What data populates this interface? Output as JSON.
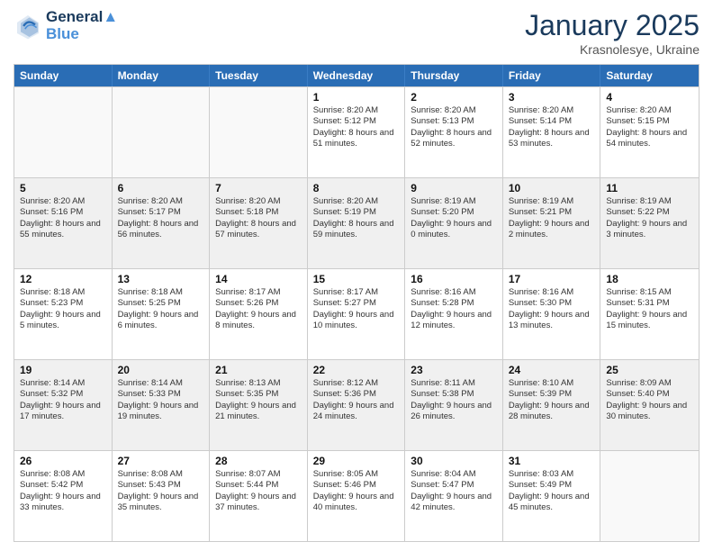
{
  "header": {
    "logo_line1": "General",
    "logo_line2": "Blue",
    "month_title": "January 2025",
    "location": "Krasnolesye, Ukraine"
  },
  "weekdays": [
    "Sunday",
    "Monday",
    "Tuesday",
    "Wednesday",
    "Thursday",
    "Friday",
    "Saturday"
  ],
  "rows": [
    [
      {
        "day": "",
        "text": ""
      },
      {
        "day": "",
        "text": ""
      },
      {
        "day": "",
        "text": ""
      },
      {
        "day": "1",
        "text": "Sunrise: 8:20 AM\nSunset: 5:12 PM\nDaylight: 8 hours and 51 minutes."
      },
      {
        "day": "2",
        "text": "Sunrise: 8:20 AM\nSunset: 5:13 PM\nDaylight: 8 hours and 52 minutes."
      },
      {
        "day": "3",
        "text": "Sunrise: 8:20 AM\nSunset: 5:14 PM\nDaylight: 8 hours and 53 minutes."
      },
      {
        "day": "4",
        "text": "Sunrise: 8:20 AM\nSunset: 5:15 PM\nDaylight: 8 hours and 54 minutes."
      }
    ],
    [
      {
        "day": "5",
        "text": "Sunrise: 8:20 AM\nSunset: 5:16 PM\nDaylight: 8 hours and 55 minutes."
      },
      {
        "day": "6",
        "text": "Sunrise: 8:20 AM\nSunset: 5:17 PM\nDaylight: 8 hours and 56 minutes."
      },
      {
        "day": "7",
        "text": "Sunrise: 8:20 AM\nSunset: 5:18 PM\nDaylight: 8 hours and 57 minutes."
      },
      {
        "day": "8",
        "text": "Sunrise: 8:20 AM\nSunset: 5:19 PM\nDaylight: 8 hours and 59 minutes."
      },
      {
        "day": "9",
        "text": "Sunrise: 8:19 AM\nSunset: 5:20 PM\nDaylight: 9 hours and 0 minutes."
      },
      {
        "day": "10",
        "text": "Sunrise: 8:19 AM\nSunset: 5:21 PM\nDaylight: 9 hours and 2 minutes."
      },
      {
        "day": "11",
        "text": "Sunrise: 8:19 AM\nSunset: 5:22 PM\nDaylight: 9 hours and 3 minutes."
      }
    ],
    [
      {
        "day": "12",
        "text": "Sunrise: 8:18 AM\nSunset: 5:23 PM\nDaylight: 9 hours and 5 minutes."
      },
      {
        "day": "13",
        "text": "Sunrise: 8:18 AM\nSunset: 5:25 PM\nDaylight: 9 hours and 6 minutes."
      },
      {
        "day": "14",
        "text": "Sunrise: 8:17 AM\nSunset: 5:26 PM\nDaylight: 9 hours and 8 minutes."
      },
      {
        "day": "15",
        "text": "Sunrise: 8:17 AM\nSunset: 5:27 PM\nDaylight: 9 hours and 10 minutes."
      },
      {
        "day": "16",
        "text": "Sunrise: 8:16 AM\nSunset: 5:28 PM\nDaylight: 9 hours and 12 minutes."
      },
      {
        "day": "17",
        "text": "Sunrise: 8:16 AM\nSunset: 5:30 PM\nDaylight: 9 hours and 13 minutes."
      },
      {
        "day": "18",
        "text": "Sunrise: 8:15 AM\nSunset: 5:31 PM\nDaylight: 9 hours and 15 minutes."
      }
    ],
    [
      {
        "day": "19",
        "text": "Sunrise: 8:14 AM\nSunset: 5:32 PM\nDaylight: 9 hours and 17 minutes."
      },
      {
        "day": "20",
        "text": "Sunrise: 8:14 AM\nSunset: 5:33 PM\nDaylight: 9 hours and 19 minutes."
      },
      {
        "day": "21",
        "text": "Sunrise: 8:13 AM\nSunset: 5:35 PM\nDaylight: 9 hours and 21 minutes."
      },
      {
        "day": "22",
        "text": "Sunrise: 8:12 AM\nSunset: 5:36 PM\nDaylight: 9 hours and 24 minutes."
      },
      {
        "day": "23",
        "text": "Sunrise: 8:11 AM\nSunset: 5:38 PM\nDaylight: 9 hours and 26 minutes."
      },
      {
        "day": "24",
        "text": "Sunrise: 8:10 AM\nSunset: 5:39 PM\nDaylight: 9 hours and 28 minutes."
      },
      {
        "day": "25",
        "text": "Sunrise: 8:09 AM\nSunset: 5:40 PM\nDaylight: 9 hours and 30 minutes."
      }
    ],
    [
      {
        "day": "26",
        "text": "Sunrise: 8:08 AM\nSunset: 5:42 PM\nDaylight: 9 hours and 33 minutes."
      },
      {
        "day": "27",
        "text": "Sunrise: 8:08 AM\nSunset: 5:43 PM\nDaylight: 9 hours and 35 minutes."
      },
      {
        "day": "28",
        "text": "Sunrise: 8:07 AM\nSunset: 5:44 PM\nDaylight: 9 hours and 37 minutes."
      },
      {
        "day": "29",
        "text": "Sunrise: 8:05 AM\nSunset: 5:46 PM\nDaylight: 9 hours and 40 minutes."
      },
      {
        "day": "30",
        "text": "Sunrise: 8:04 AM\nSunset: 5:47 PM\nDaylight: 9 hours and 42 minutes."
      },
      {
        "day": "31",
        "text": "Sunrise: 8:03 AM\nSunset: 5:49 PM\nDaylight: 9 hours and 45 minutes."
      },
      {
        "day": "",
        "text": ""
      }
    ]
  ]
}
